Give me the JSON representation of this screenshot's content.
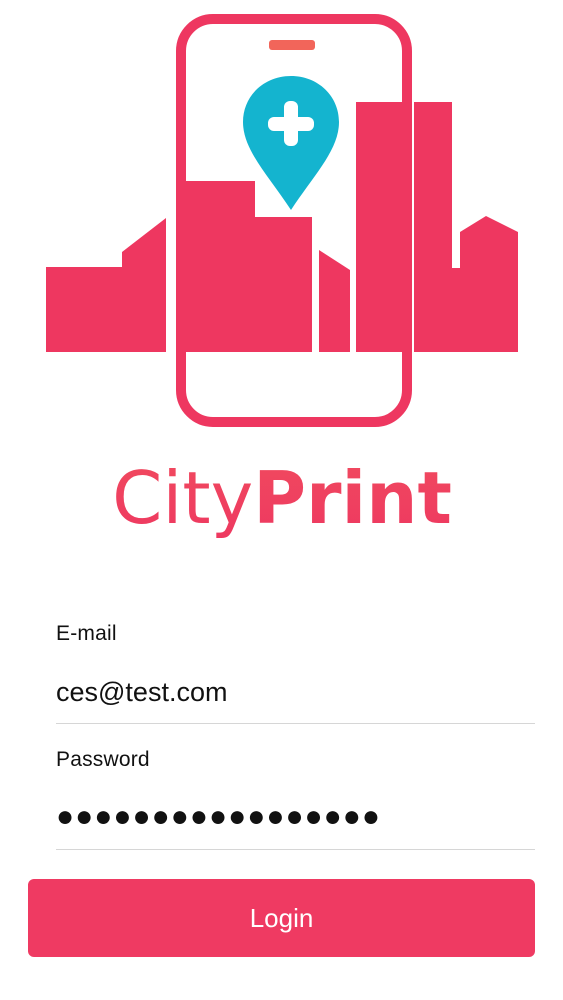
{
  "brand": {
    "name_light": "City",
    "name_bold": "Print",
    "colors": {
      "gradient_top": "#f2655a",
      "gradient_bottom": "#ee3760",
      "pin": "#14b4cf"
    }
  },
  "icons": {
    "phone": "phone-icon",
    "location_pin": "location-pin-plus-icon",
    "skyline": "city-skyline-icon"
  },
  "form": {
    "email": {
      "label": "E-mail",
      "value": "ces@test.com"
    },
    "password": {
      "label": "Password",
      "value": "●●●●●●●●●●●●●●●●●"
    },
    "login_label": "Login"
  },
  "theme": {
    "button_color": "#ef3a62",
    "divider_color": "#d6d6d6"
  }
}
